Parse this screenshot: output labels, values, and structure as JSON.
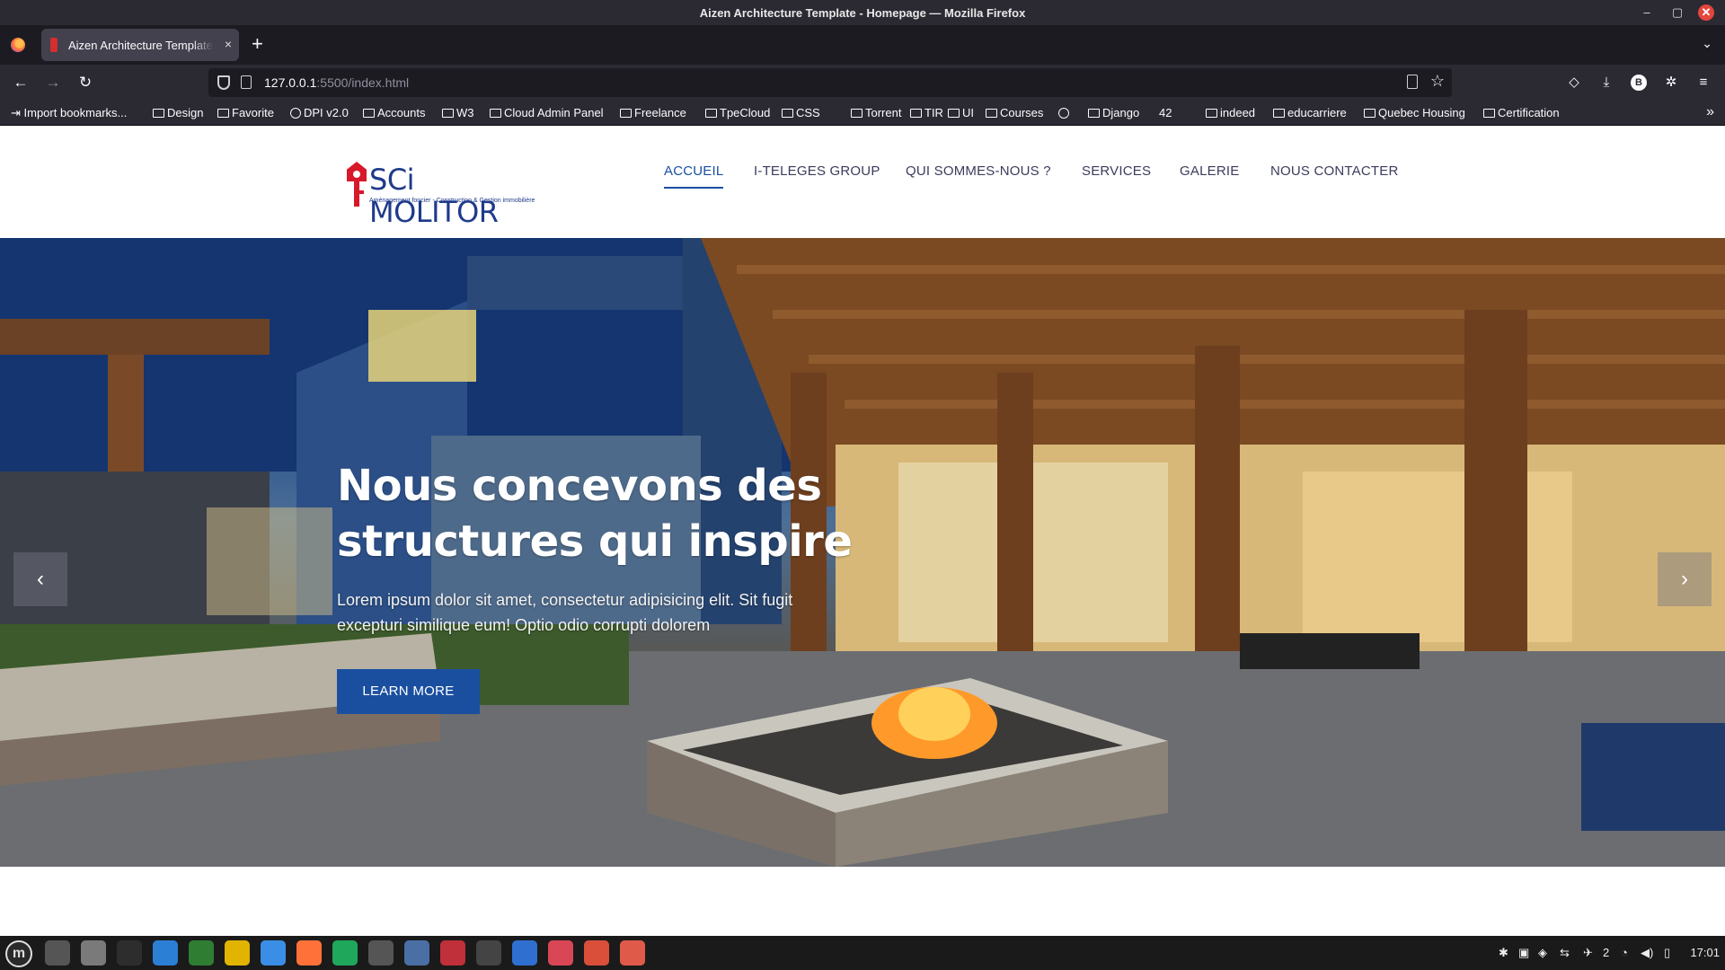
{
  "window": {
    "title": "Aizen Architecture Template - Homepage — Mozilla Firefox",
    "controls": {
      "minimize": "–",
      "maximize": "▢",
      "close": "✕"
    }
  },
  "tabs": [
    {
      "label": "Aizen Architecture Template - Homepage",
      "active": true
    }
  ],
  "tab_controls": {
    "close": "×",
    "new_tab": "+",
    "list_all": "⌄"
  },
  "navigation": {
    "back": "←",
    "forward": "→",
    "reload": "↻",
    "url_host": "127.0.0.1",
    "url_path": ":5500/index.html",
    "bookmark_star": "☆"
  },
  "toolbar": {
    "pocket": "◇",
    "downloads": "⤓",
    "profile": "B",
    "extensions": "✲",
    "menu": "≡"
  },
  "bookmarks": [
    {
      "label": "Import bookmarks...",
      "icon": "import-icon"
    },
    {
      "label": "Design",
      "icon": "folder-icon"
    },
    {
      "label": "Favorite",
      "icon": "folder-icon"
    },
    {
      "label": "DPI v2.0",
      "icon": "globe-icon"
    },
    {
      "label": "Accounts",
      "icon": "folder-icon"
    },
    {
      "label": "W3",
      "icon": "folder-icon"
    },
    {
      "label": "Cloud Admin Panel",
      "icon": "folder-icon"
    },
    {
      "label": "Freelance",
      "icon": "folder-icon"
    },
    {
      "label": "TpeCloud",
      "icon": "folder-icon"
    },
    {
      "label": "CSS",
      "icon": "folder-icon"
    },
    {
      "label": "Torrent",
      "icon": "folder-icon"
    },
    {
      "label": "TIR",
      "icon": "folder-icon"
    },
    {
      "label": "UI",
      "icon": "folder-icon"
    },
    {
      "label": "Courses",
      "icon": "folder-icon"
    },
    {
      "label": "",
      "icon": "globe-icon"
    },
    {
      "label": "Django",
      "icon": "folder-icon"
    },
    {
      "label": "42",
      "icon": "none"
    },
    {
      "label": "indeed",
      "icon": "folder-icon"
    },
    {
      "label": "educarriere",
      "icon": "folder-icon"
    },
    {
      "label": "Quebec Housing",
      "icon": "folder-icon"
    },
    {
      "label": "Certification",
      "icon": "folder-icon"
    }
  ],
  "bookmarks_overflow": "»",
  "site": {
    "logo": {
      "name": "SCi MOLITOR",
      "tagline": "Aménagement foncier - Construction & Gestion immobilière"
    },
    "menu": [
      {
        "label": "ACCUEIL",
        "active": true
      },
      {
        "label": "I-TELEGES GROUP",
        "active": false
      },
      {
        "label": "QUI SOMMES-NOUS ?",
        "active": false
      },
      {
        "label": "SERVICES",
        "active": false
      },
      {
        "label": "GALERIE",
        "active": false
      },
      {
        "label": "NOUS CONTACTER",
        "active": false
      }
    ],
    "hero": {
      "title_line1": "Nous concevons des",
      "title_line2": "structures qui inspire",
      "text": "Lorem ipsum dolor sit amet, consectetur adipisicing elit. Sit fugit excepturi similique eum! Optio odio corrupti dolorem",
      "button": "LEARN MORE",
      "prev": "‹",
      "next": "›"
    }
  },
  "taskbar": {
    "menu_glyph": "m",
    "apps": [
      "files-manager",
      "folder",
      "terminal",
      "vscode",
      "system-monitor",
      "bracket-app",
      "notes-app",
      "firefox",
      "gitkraken",
      "calculator",
      "postgres",
      "reader",
      "inkscape",
      "text-editor",
      "glasses-app",
      "git-app",
      "image-viewer"
    ],
    "workspace_badge": "2",
    "tray_wifi_count": "2",
    "clock": "17:01"
  },
  "colors": {
    "accent": "#1a4fa0",
    "logo_red": "#d7192a",
    "browser_chrome": "#2b2a33",
    "tab_strip": "#1c1b22"
  }
}
